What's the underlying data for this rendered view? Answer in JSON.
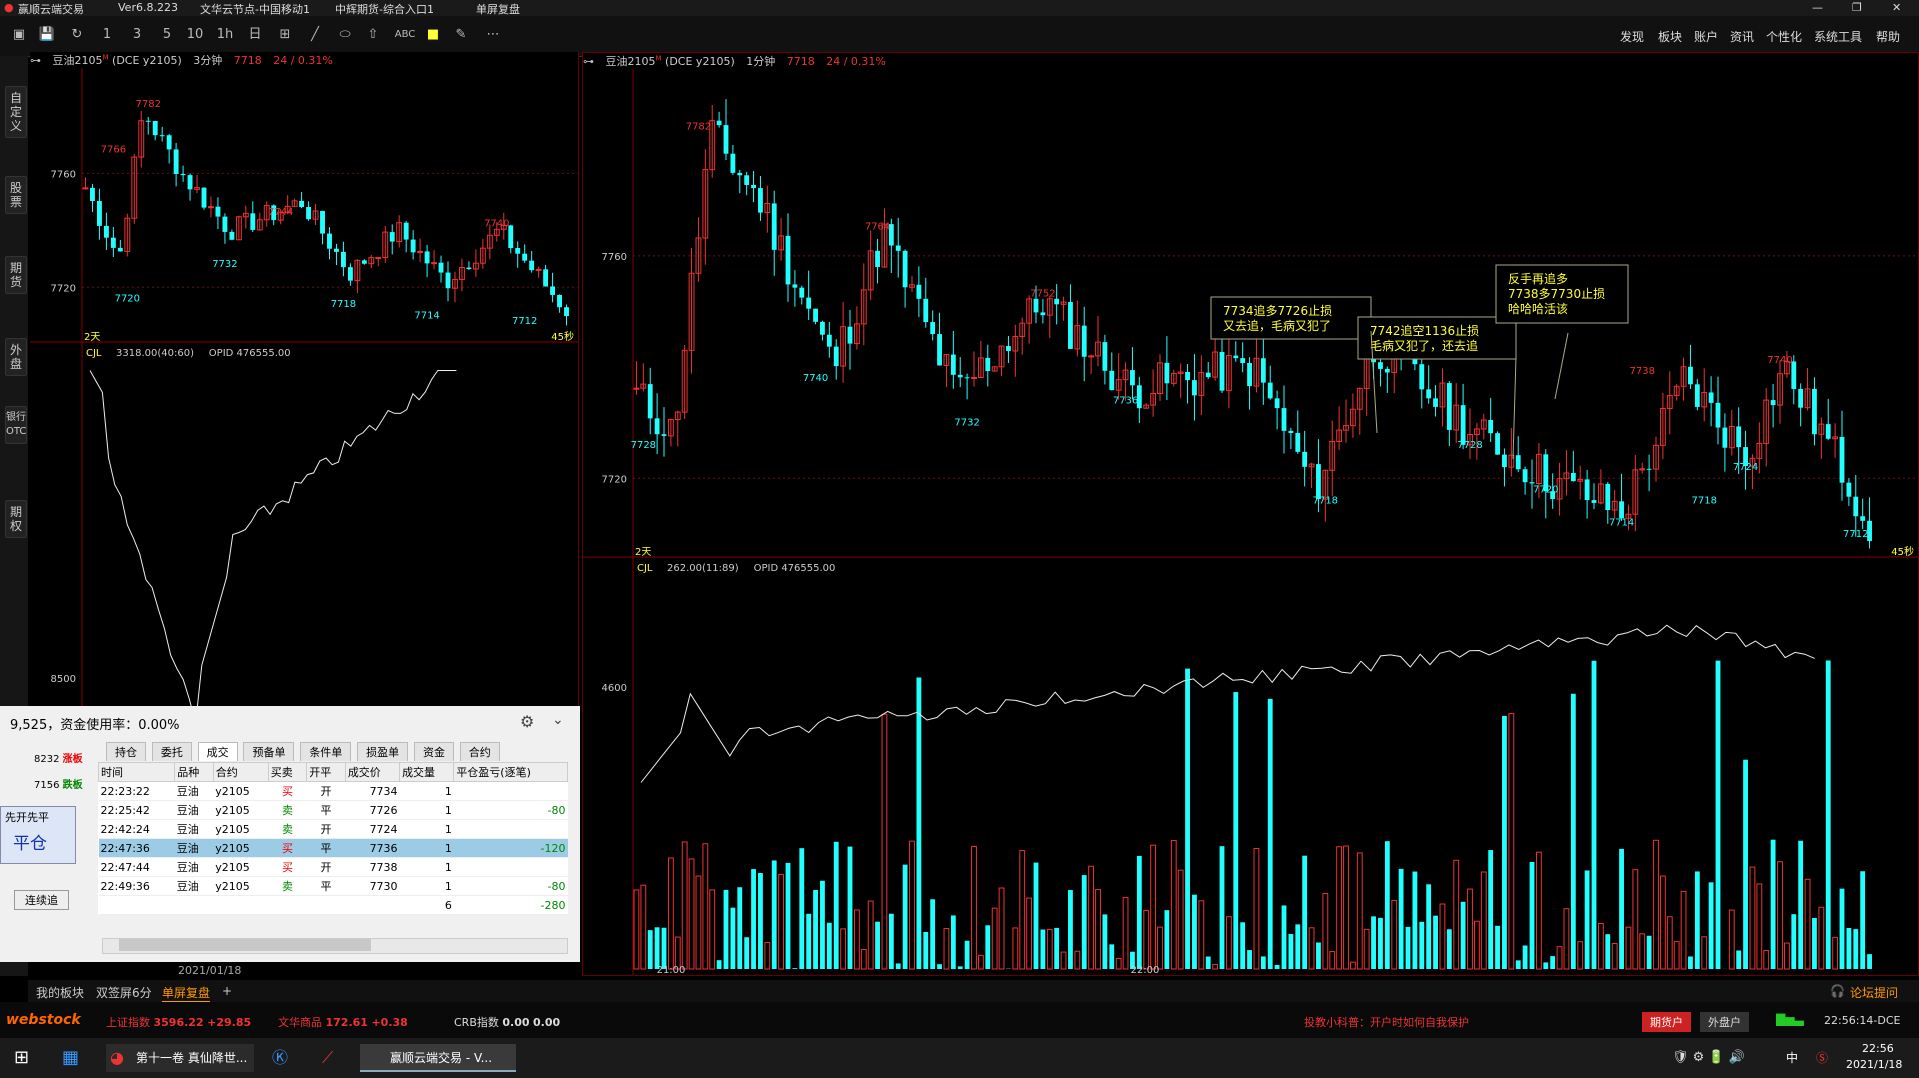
{
  "window": {
    "title": "赢顺云端交易",
    "version": "Ver6.8.223",
    "node": "文华云节点-中国移动1",
    "broker": "中辉期货-综合入口1",
    "mode": "单屏复盘",
    "min": "—",
    "max": "❐",
    "close": "✕"
  },
  "menu": [
    "发现",
    "板块",
    "账户",
    "资讯",
    "个性化",
    "系统工具",
    "帮助"
  ],
  "toolbar": {
    "periods": [
      "1",
      "3",
      "5",
      "10",
      "1h",
      "日"
    ],
    "abc": "ABC"
  },
  "lefttabs": [
    "自定义",
    "股票",
    "期货",
    "外盘",
    "银行OTC",
    "期权"
  ],
  "left_chart": {
    "symbol": "豆油2105",
    "sup": "M",
    "exchange": "(DCE y2105)",
    "period": "3分钟",
    "price": "7718",
    "change": "24 / 0.31%",
    "y_labels": [
      "7760",
      "7720"
    ],
    "span_label": "2天",
    "right_label": "45秒",
    "vol_header": "CJL",
    "vol_value": "3318.00(40:60)",
    "opid": "OPID 476555.00",
    "vol_ylabel": "8500",
    "annotations_high": [
      "7782",
      "7766",
      "7744",
      "7740"
    ],
    "annotations_low": [
      "7720",
      "7732",
      "7718",
      "7714",
      "7712"
    ]
  },
  "right_chart": {
    "symbol": "豆油2105",
    "sup": "M",
    "exchange": "(DCE y2105)",
    "period": "1分钟",
    "price": "7718",
    "change": "24 / 0.31%",
    "y_labels": [
      "7760",
      "7720"
    ],
    "span_label": "2天",
    "right_label": "45秒",
    "vol_header": "CJL",
    "vol_value": "262.00(11:89)",
    "opid": "OPID 476555.00",
    "vol_ylabel": "4600",
    "x_labels": [
      "21:00",
      "22:00"
    ],
    "annotations_high": [
      "7782",
      "7764",
      "7752",
      "7744",
      "7738",
      "7740"
    ],
    "annotations_low": [
      "7728",
      "7740",
      "7732",
      "7736",
      "7718",
      "7728",
      "7720",
      "7714",
      "7718",
      "7724",
      "7712"
    ],
    "notes": [
      {
        "lines": [
          "7734追多7726止损",
          "又去追，毛病又犯了"
        ]
      },
      {
        "lines": [
          "7742追空1136止损",
          "毛病又犯了，还去追"
        ]
      },
      {
        "lines": [
          "反手再追多",
          "7738多7730止损",
          "哈哈哈活该"
        ]
      }
    ]
  },
  "trade_panel": {
    "summary": "9,525，资金使用率：0.00%",
    "limit_up_price": "8232",
    "limit_up_label": "涨板",
    "limit_down_price": "7156",
    "limit_down_label": "跌板",
    "strategy": "先开先平",
    "close_btn": "平仓",
    "chase_btn": "连续追",
    "date": "2021/01/18",
    "tabs": [
      "持仓",
      "委托",
      "成交",
      "预备单",
      "条件单",
      "损盈单",
      "资金",
      "合约"
    ],
    "active_tab": "成交",
    "columns": [
      "时间",
      "品种",
      "合约",
      "买卖",
      "开平",
      "成交价",
      "成交量",
      "平仓盈亏(逐笔)"
    ],
    "rows": [
      {
        "time": "22:23:22",
        "product": "豆油",
        "contract": "y2105",
        "side": "买",
        "oc": "开",
        "price": "7734",
        "qty": "1",
        "pnl": ""
      },
      {
        "time": "22:25:42",
        "product": "豆油",
        "contract": "y2105",
        "side": "卖",
        "oc": "平",
        "price": "7726",
        "qty": "1",
        "pnl": "-80"
      },
      {
        "time": "22:42:24",
        "product": "豆油",
        "contract": "y2105",
        "side": "卖",
        "oc": "开",
        "price": "7724",
        "qty": "1",
        "pnl": ""
      },
      {
        "time": "22:47:36",
        "product": "豆油",
        "contract": "y2105",
        "side": "买",
        "oc": "平",
        "price": "7736",
        "qty": "1",
        "pnl": "-120"
      },
      {
        "time": "22:47:44",
        "product": "豆油",
        "contract": "y2105",
        "side": "买",
        "oc": "开",
        "price": "7738",
        "qty": "1",
        "pnl": ""
      },
      {
        "time": "22:49:36",
        "product": "豆油",
        "contract": "y2105",
        "side": "卖",
        "oc": "平",
        "price": "7730",
        "qty": "1",
        "pnl": "-80"
      }
    ],
    "total_qty": "6",
    "total_pnl": "-280"
  },
  "bottom_tabs": [
    "我的板块",
    "双签屏6分",
    "单屏复盘",
    "+"
  ],
  "forum": "论坛提问",
  "status": {
    "brand": "webstock",
    "idx1_name": "上证指数",
    "idx1_val": "3596.22",
    "idx1_chg": "+29.85",
    "idx2_name": "文华商品",
    "idx2_val": "172.61",
    "idx2_chg": "+0.38",
    "idx3_name": "CRB指数",
    "idx3_val": "0.00",
    "idx3_chg": "0.00",
    "tip": "投教小科普：开户时如何自我保护",
    "acct1": "期货户",
    "acct2": "外盘户",
    "clock": "22:56:14-DCE"
  },
  "taskbar": {
    "task1": "第十一卷 真仙降世...",
    "task2": "赢顺云端交易 - V...",
    "time": "22:56",
    "date": "2021/1/18",
    "ime": "中"
  }
}
